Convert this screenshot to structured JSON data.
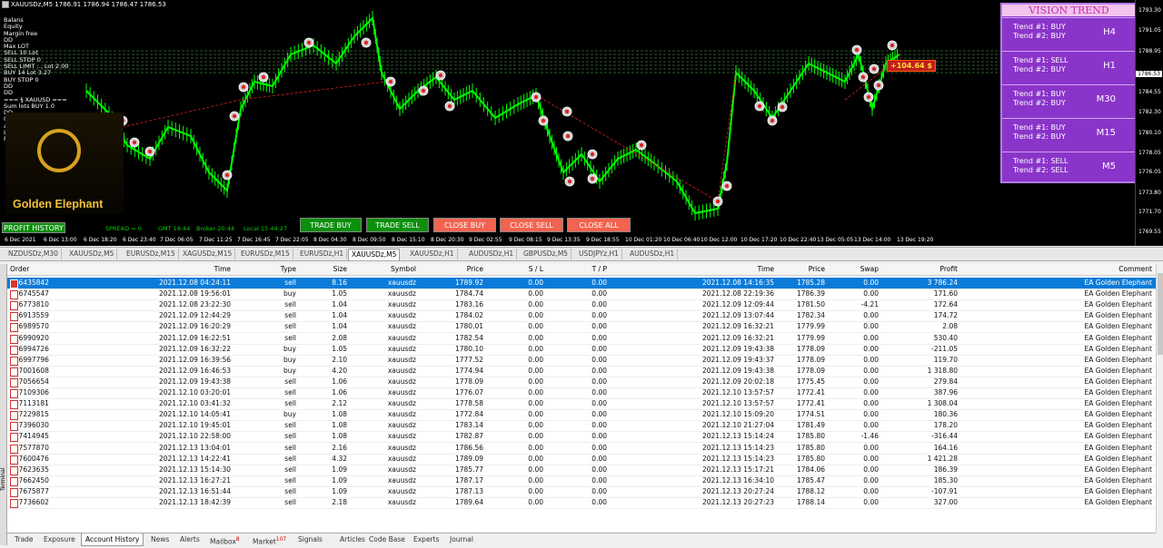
{
  "chart": {
    "title": "XAUUSDz,M5  1786.91 1786.94 1786.47 1786.53",
    "info_lines": [
      "Balans",
      "Equity",
      "Margin free",
      "DD",
      "",
      "",
      "",
      "",
      "",
      "",
      "Max LOT",
      "",
      "SELL        10  Lot",
      "SELL STOP      0",
      "SELL LIMIT   ...  Lot  2.00",
      "BUY         14  Lot  3.27",
      "BUY STOP    0",
      "",
      "DD",
      "DD",
      "",
      "=== § XAUUSD ===",
      "Sum lots BUY   1.0",
      "DD              ...",
      "",
      "Count closed orders",
      "at period       1451",
      "Lot...",
      "Profit..."
    ],
    "logo_text": "Golden Elephant",
    "buttons": {
      "profit_history": "PROFIT HISTORY",
      "trade_buy": "TRADE BUY",
      "trade_sell": "TRADE SELL",
      "close_buy": "CLOSE BUY",
      "close_sell": "CLOSE SELL",
      "close_all": "CLOSE ALL"
    },
    "status": {
      "spread": "SPREAD = 0",
      "gmt": "GMT 18:44",
      "broker": "Broker 20:44",
      "local": "Local 15:44:27"
    },
    "price_axis": [
      "1793.30",
      "1791.05",
      "1788.95",
      "1786.53",
      "1784.55",
      "1782.30",
      "1780.10",
      "1778.05",
      "1776.05",
      "1773.80",
      "1771.70",
      "1769.55"
    ],
    "current_price": "1786.53",
    "time_axis": [
      "6 Dec 2021",
      "6 Dec 13:00",
      "6 Dec 18:20",
      "6 Dec 23:40",
      "7 Dec 06:05",
      "7 Dec 11:25",
      "7 Dec 16:45",
      "7 Dec 22:05",
      "8 Dec 04:30",
      "8 Dec 09:50",
      "8 Dec 15:10",
      "8 Dec 20:30",
      "9 Dec 02:55",
      "9 Dec 08:15",
      "9 Dec 13:35",
      "9 Dec 18:55",
      "10 Dec 01:20",
      "10 Dec 06:40",
      "10 Dec 12:00",
      "10 Dec 17:20",
      "10 Dec 22:40",
      "13 Dec 05:05",
      "13 Dec 14:00",
      "13 Dec 19:20"
    ],
    "profit_tag": "+104.64 $",
    "close_icon": "close-icon"
  },
  "trend_panel": {
    "title": "VISION TREND",
    "rows": [
      {
        "t1": "Trend #1: BUY",
        "t2": "Trend #2: BUY",
        "tf": "H4"
      },
      {
        "t1": "Trend #1: SELL",
        "t2": "Trend #2: BUY",
        "tf": "H1"
      },
      {
        "t1": "Trend #1: BUY",
        "t2": "Trend #2: BUY",
        "tf": "M30"
      },
      {
        "t1": "Trend #1: BUY",
        "t2": "Trend #2: BUY",
        "tf": "M15"
      },
      {
        "t1": "Trend #1: SELL",
        "t2": "Trend #2: SELL",
        "tf": "M5"
      }
    ]
  },
  "chart_tabs": [
    "NZDUSDz,M30",
    "XAUUSDz,M5",
    "EURUSDz,M15",
    "XAGUSDz,M15",
    "EURUSDz,M15",
    "EURUSDz,H1",
    "XAUUSDz,M5",
    "XAUUSDz,H1",
    "AUDUSDz,H1",
    "GBPUSDz,M5",
    "USDJPYz,H1",
    "AUDUSDz,H1"
  ],
  "active_chart_tab": 6,
  "table": {
    "headers": [
      "Order",
      "Time",
      "Type",
      "Size",
      "Symbol",
      "Price",
      "S / L",
      "T / P",
      "Time",
      "Price",
      "Swap",
      "Profit",
      "Comment"
    ],
    "rows": [
      [
        "666435842",
        "2021.12.08 04:24:11",
        "sell",
        "8.16",
        "xauusdz",
        "1789.92",
        "0.00",
        "0.00",
        "2021.12.08 14:16:35",
        "1785.28",
        "0.00",
        "3 786.24",
        "EA Golden Elephant"
      ],
      [
        "666745547",
        "2021.12.08 19:56:01",
        "buy",
        "1.05",
        "xauusdz",
        "1784.74",
        "0.00",
        "0.00",
        "2021.12.08 22:19:36",
        "1786.39",
        "0.00",
        "171.60",
        "EA Golden Elephant"
      ],
      [
        "666773810",
        "2021.12.08 23:22:30",
        "sell",
        "1.04",
        "xauusdz",
        "1783.16",
        "0.00",
        "0.00",
        "2021.12.09 12:09:44",
        "1781.50",
        "-4.21",
        "172.64",
        "EA Golden Elephant"
      ],
      [
        "666913559",
        "2021.12.09 12:44:29",
        "sell",
        "1.04",
        "xauusdz",
        "1784.02",
        "0.00",
        "0.00",
        "2021.12.09 13:07:44",
        "1782.34",
        "0.00",
        "174.72",
        "EA Golden Elephant"
      ],
      [
        "666989570",
        "2021.12.09 16:20:29",
        "sell",
        "1.04",
        "xauusdz",
        "1780.01",
        "0.00",
        "0.00",
        "2021.12.09 16:32:21",
        "1779.99",
        "0.00",
        "2.08",
        "EA Golden Elephant"
      ],
      [
        "666990920",
        "2021.12.09 16:22:51",
        "sell",
        "2.08",
        "xauusdz",
        "1782.54",
        "0.00",
        "0.00",
        "2021.12.09 16:32:21",
        "1779.99",
        "0.00",
        "530.40",
        "EA Golden Elephant"
      ],
      [
        "666994726",
        "2021.12.09 16:32:22",
        "buy",
        "1.05",
        "xauusdz",
        "1780.10",
        "0.00",
        "0.00",
        "2021.12.09 19:43:38",
        "1778.09",
        "0.00",
        "-211.05",
        "EA Golden Elephant"
      ],
      [
        "666997796",
        "2021.12.09 16:39:56",
        "buy",
        "2.10",
        "xauusdz",
        "1777.52",
        "0.00",
        "0.00",
        "2021.12.09 19:43:37",
        "1778.09",
        "0.00",
        "119.70",
        "EA Golden Elephant"
      ],
      [
        "667001608",
        "2021.12.09 16:46:53",
        "buy",
        "4.20",
        "xauusdz",
        "1774.94",
        "0.00",
        "0.00",
        "2021.12.09 19:43:38",
        "1778.09",
        "0.00",
        "1 318.80",
        "EA Golden Elephant"
      ],
      [
        "667056654",
        "2021.12.09 19:43:38",
        "sell",
        "1.06",
        "xauusdz",
        "1778.09",
        "0.00",
        "0.00",
        "2021.12.09 20:02:18",
        "1775.45",
        "0.00",
        "279.84",
        "EA Golden Elephant"
      ],
      [
        "667109306",
        "2021.12.10 03:20:01",
        "sell",
        "1.06",
        "xauusdz",
        "1776.07",
        "0.00",
        "0.00",
        "2021.12.10 13:57:57",
        "1772.41",
        "0.00",
        "387.96",
        "EA Golden Elephant"
      ],
      [
        "667113181",
        "2021.12.10 03:41:32",
        "sell",
        "2.12",
        "xauusdz",
        "1778.58",
        "0.00",
        "0.00",
        "2021.12.10 13:57:57",
        "1772.41",
        "0.00",
        "1 308.04",
        "EA Golden Elephant"
      ],
      [
        "667229815",
        "2021.12.10 14:05:41",
        "buy",
        "1.08",
        "xauusdz",
        "1772.84",
        "0.00",
        "0.00",
        "2021.12.10 15:09:20",
        "1774.51",
        "0.00",
        "180.36",
        "EA Golden Elephant"
      ],
      [
        "667396030",
        "2021.12.10 19:45:01",
        "sell",
        "1.08",
        "xauusdz",
        "1783.14",
        "0.00",
        "0.00",
        "2021.12.10 21:27:04",
        "1781.49",
        "0.00",
        "178.20",
        "EA Golden Elephant"
      ],
      [
        "667414945",
        "2021.12.10 22:58:00",
        "sell",
        "1.08",
        "xauusdz",
        "1782.87",
        "0.00",
        "0.00",
        "2021.12.13 15:14:24",
        "1785.80",
        "-1.46",
        "-316.44",
        "EA Golden Elephant"
      ],
      [
        "667577870",
        "2021.12.13 13:04:01",
        "sell",
        "2.16",
        "xauusdz",
        "1786.56",
        "0.00",
        "0.00",
        "2021.12.13 15:14:23",
        "1785.80",
        "0.00",
        "164.16",
        "EA Golden Elephant"
      ],
      [
        "667600476",
        "2021.12.13 14:22:41",
        "sell",
        "4.32",
        "xauusdz",
        "1789.09",
        "0.00",
        "0.00",
        "2021.12.13 15:14:23",
        "1785.80",
        "0.00",
        "1 421.28",
        "EA Golden Elephant"
      ],
      [
        "667623635",
        "2021.12.13 15:14:30",
        "sell",
        "1.09",
        "xauusdz",
        "1785.77",
        "0.00",
        "0.00",
        "2021.12.13 15:17:21",
        "1784.06",
        "0.00",
        "186.39",
        "EA Golden Elephant"
      ],
      [
        "667662450",
        "2021.12.13 16:27:21",
        "sell",
        "1.09",
        "xauusdz",
        "1787.17",
        "0.00",
        "0.00",
        "2021.12.13 16:34:10",
        "1785.47",
        "0.00",
        "185.30",
        "EA Golden Elephant"
      ],
      [
        "667675877",
        "2021.12.13 16:51:44",
        "sell",
        "1.09",
        "xauusdz",
        "1787.13",
        "0.00",
        "0.00",
        "2021.12.13 20:27:24",
        "1788.12",
        "0.00",
        "-107.91",
        "EA Golden Elephant"
      ],
      [
        "667736602",
        "2021.12.13 18:42:39",
        "sell",
        "2.18",
        "xauusdz",
        "1789.64",
        "0.00",
        "0.00",
        "2021.12.13 20:27:23",
        "1788.14",
        "0.00",
        "327.00",
        "EA Golden Elephant"
      ]
    ]
  },
  "terminal_label": "Terminal",
  "bottom_tabs": [
    {
      "label": "Trade",
      "badge": ""
    },
    {
      "label": "Exposure",
      "badge": ""
    },
    {
      "label": "Account History",
      "badge": ""
    },
    {
      "label": "News",
      "badge": ""
    },
    {
      "label": "Alerts",
      "badge": ""
    },
    {
      "label": "Mailbox",
      "badge": "8"
    },
    {
      "label": "Market",
      "badge": "107"
    },
    {
      "label": "Signals",
      "badge": ""
    },
    {
      "label": "Articles",
      "badge": ""
    },
    {
      "label": "Code Base",
      "badge": ""
    },
    {
      "label": "Experts",
      "badge": ""
    },
    {
      "label": "Journal",
      "badge": ""
    }
  ],
  "active_bottom_tab": 2,
  "colors": {
    "chart_bg": "#000000",
    "candles": "#00ff00",
    "selected_row": "#0a7bd8",
    "trend_bg": "#8a35c9"
  }
}
